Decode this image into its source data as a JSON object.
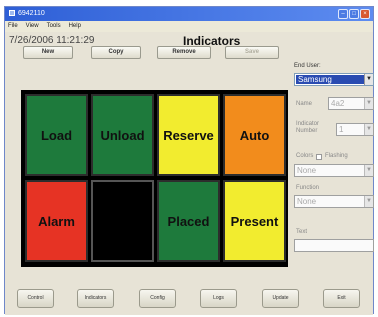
{
  "window": {
    "title": "6942110",
    "menu": [
      "File",
      "View",
      "Tools",
      "Help"
    ]
  },
  "header": {
    "datetime": "7/26/2006 11:21:29",
    "title": "Indicators"
  },
  "toolbar": {
    "new_label": "New",
    "copy_label": "Copy",
    "remove_label": "Remove",
    "save_label": "Save"
  },
  "tiles": [
    {
      "label": "Load",
      "color": "#1e7a3c"
    },
    {
      "label": "Unload",
      "color": "#1e7a3c"
    },
    {
      "label": "Reserve",
      "color": "#f2ec2f"
    },
    {
      "label": "Auto",
      "color": "#f28c1c"
    },
    {
      "label": "Alarm",
      "color": "#e63324"
    },
    {
      "label": "",
      "color": "#000000"
    },
    {
      "label": "Placed",
      "color": "#1e7a3c"
    },
    {
      "label": "Present",
      "color": "#f2ec2f"
    }
  ],
  "side_panel": {
    "end_user_label": "End User:",
    "end_user_value": "Samsung",
    "name_label": "Name",
    "name_value": "4a2",
    "indicator_number_label": "Indicator Number",
    "indicator_number_value": "1",
    "colors_label": "Colors",
    "flashing_label": "Flashing",
    "color_value": "None",
    "function_label": "Function",
    "function_value": "None",
    "text_label": "Text"
  },
  "bottom_nav": {
    "control": "Control",
    "indicators": "Indicators",
    "config": "Config",
    "logs": "Logs",
    "update": "Update",
    "exit": "Exit"
  }
}
